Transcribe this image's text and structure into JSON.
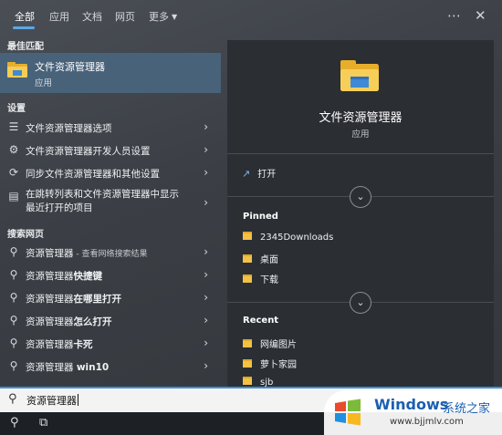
{
  "tabs": [
    "全部",
    "应用",
    "文档",
    "网页",
    "更多"
  ],
  "left": {
    "best_match_header": "最佳匹配",
    "best_match": {
      "title": "文件资源管理器",
      "subtitle": "应用"
    },
    "settings_header": "设置",
    "settings": [
      {
        "icon": "list-settings-icon",
        "label": "文件资源管理器选项"
      },
      {
        "icon": "developer-icon",
        "label": "文件资源管理器开发人员设置"
      },
      {
        "icon": "sync-icon",
        "label": "同步文件资源管理器和其他设置"
      },
      {
        "icon": "jumplist-icon",
        "label_line1": "在跳转列表和文件资源管理器中显示",
        "label_line2": "最近打开的项目"
      }
    ],
    "web_header": "搜索网页",
    "web": [
      {
        "plain": "资源管理器",
        "bold": "",
        "suffix": " - 查看网络搜索结果"
      },
      {
        "plain": "资源管理器",
        "bold": "快捷键",
        "suffix": ""
      },
      {
        "plain": "资源管理器",
        "bold": "在哪里打开",
        "suffix": ""
      },
      {
        "plain": "资源管理器",
        "bold": "怎么打开",
        "suffix": ""
      },
      {
        "plain": "资源管理器",
        "bold": "卡死",
        "suffix": ""
      },
      {
        "plain": "资源管理器 ",
        "bold": "win10",
        "suffix": ""
      }
    ]
  },
  "right": {
    "title": "文件资源管理器",
    "subtitle": "应用",
    "open_label": "打开",
    "pinned_header": "Pinned",
    "pinned": [
      "2345Downloads",
      "桌面",
      "下载"
    ],
    "recent_header": "Recent",
    "recent": [
      "网编图片",
      "萝卜家园",
      "sjb"
    ]
  },
  "search": {
    "value": "资源管理器"
  },
  "watermark": {
    "name": "Windows",
    "cn": "系统之家",
    "url": "www.bjjmlv.com"
  },
  "colors": {
    "accent": "#5aa7e8",
    "selected": "#48627a",
    "folder": "#f2c245"
  }
}
